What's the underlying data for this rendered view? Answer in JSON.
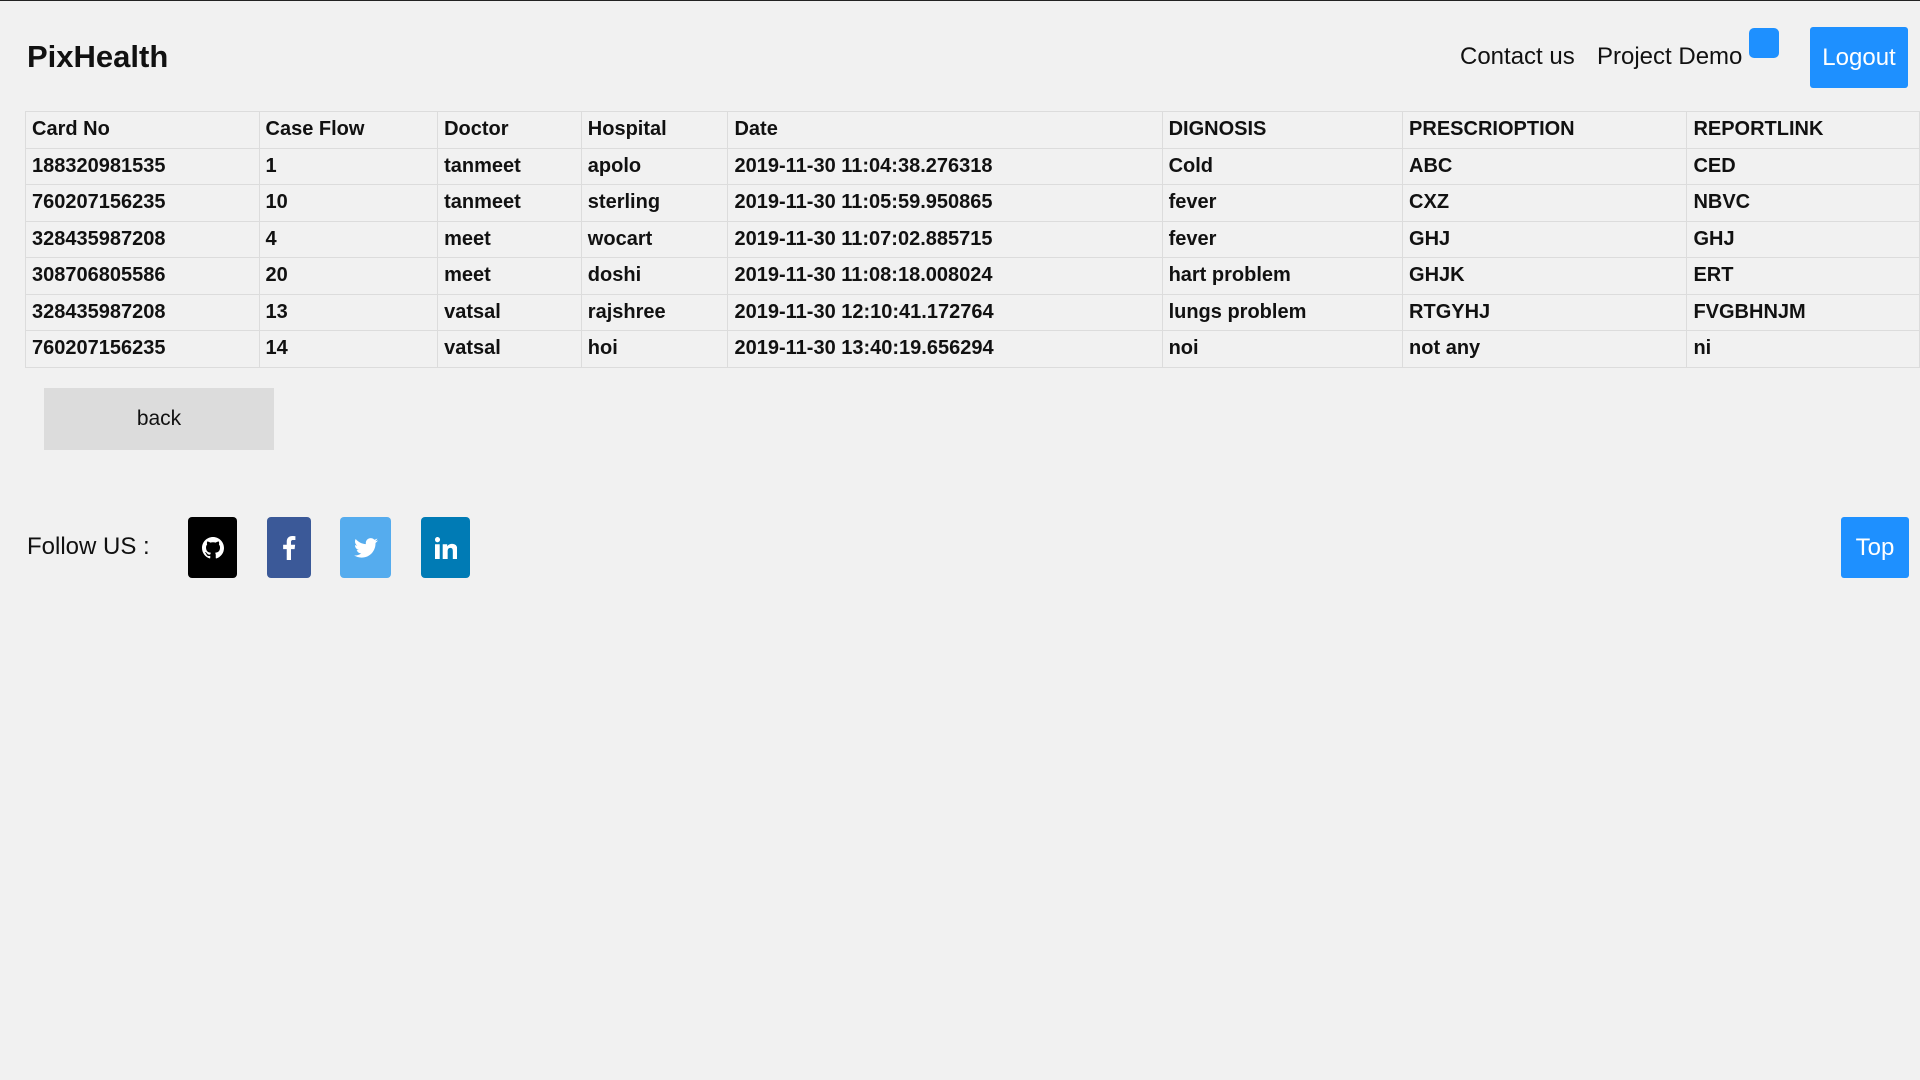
{
  "header": {
    "brand": "PixHealth",
    "nav": {
      "contact": "Contact us",
      "demo": "Project Demo",
      "logout": "Logout"
    }
  },
  "table": {
    "columns": [
      "Card No",
      "Case Flow",
      "Doctor",
      "Hospital",
      "Date",
      "DIGNOSIS",
      "PRESCRIOPTION",
      "REPORTLINK"
    ],
    "rows": [
      [
        "188320981535",
        "1",
        "tanmeet",
        "apolo",
        "2019-11-30 11:04:38.276318",
        "Cold",
        "ABC",
        "CED"
      ],
      [
        "760207156235",
        "10",
        "tanmeet",
        "sterling",
        "2019-11-30 11:05:59.950865",
        "fever",
        "CXZ",
        "NBVC"
      ],
      [
        "328435987208",
        "4",
        "meet",
        "wocart",
        "2019-11-30 11:07:02.885715",
        "fever",
        "GHJ",
        "GHJ"
      ],
      [
        "308706805586",
        "20",
        "meet",
        "doshi",
        "2019-11-30 11:08:18.008024",
        "hart problem",
        "GHJK",
        "ERT"
      ],
      [
        "328435987208",
        "13",
        "vatsal",
        "rajshree",
        "2019-11-30 12:10:41.172764",
        "lungs problem",
        "RTGYHJ",
        "FVGBHNJM"
      ],
      [
        "760207156235",
        "14",
        "vatsal",
        "hoi",
        "2019-11-30 13:40:19.656294",
        "noi",
        "not any",
        "ni"
      ]
    ]
  },
  "back_label": "back",
  "footer": {
    "follow_label": "Follow US :",
    "social": [
      {
        "name": "github",
        "icon": "github-icon",
        "color": "#000000"
      },
      {
        "name": "facebook",
        "icon": "facebook-icon",
        "color": "#3b5998"
      },
      {
        "name": "twitter",
        "icon": "twitter-icon",
        "color": "#55acee"
      },
      {
        "name": "linkedin",
        "icon": "linkedin-icon",
        "color": "#007bb5"
      }
    ],
    "top_label": "Top"
  },
  "colors": {
    "accent": "#1e90ff",
    "background": "#f1f1f1",
    "back_button": "#dcdcdc"
  }
}
